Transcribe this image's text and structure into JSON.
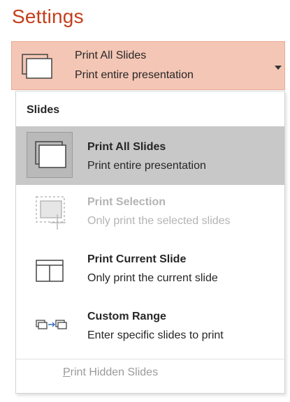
{
  "header": {
    "title": "Settings"
  },
  "dropdown": {
    "title": "Print All Slides",
    "subtitle": "Print entire presentation",
    "icon": "slides-stack-icon",
    "arrow_icon": "dropdown-arrow-icon"
  },
  "menu": {
    "section_header": "Slides",
    "items": [
      {
        "label": "Print All Slides",
        "description": "Print entire presentation",
        "icon": "print-all-slides-icon",
        "state": "selected"
      },
      {
        "label": "Print Selection",
        "description": "Only print the selected slides",
        "icon": "print-selection-icon",
        "state": "disabled"
      },
      {
        "label": "Print Current Slide",
        "description": "Only print the current slide",
        "icon": "print-current-slide-icon",
        "state": "normal"
      },
      {
        "label": "Custom Range",
        "description": "Enter specific slides to print",
        "icon": "custom-range-icon",
        "state": "normal"
      }
    ],
    "footer_option": {
      "mnemonic": "P",
      "rest": "rint Hidden Slides",
      "state": "disabled"
    }
  },
  "colors": {
    "accent": "#c43e1c",
    "dropdown_bg": "#f4c6b5",
    "selected_bg": "#c8c8c8",
    "disabled_text": "#b4b4b4"
  }
}
